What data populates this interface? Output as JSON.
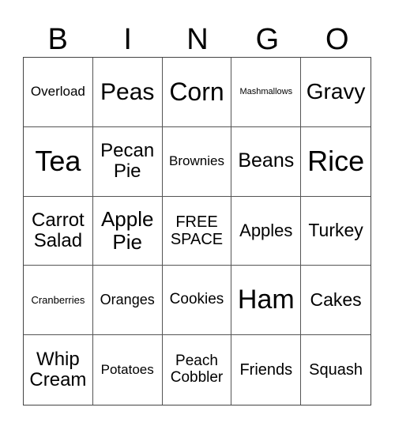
{
  "header": [
    "B",
    "I",
    "N",
    "G",
    "O"
  ],
  "cells": [
    {
      "text": "Overload",
      "size": 17
    },
    {
      "text": "Peas",
      "size": 30
    },
    {
      "text": "Corn",
      "size": 32
    },
    {
      "text": "Mashmallows",
      "size": 11
    },
    {
      "text": "Gravy",
      "size": 28
    },
    {
      "text": "Tea",
      "size": 36
    },
    {
      "text": "Pecan Pie",
      "size": 24
    },
    {
      "text": "Brownies",
      "size": 17
    },
    {
      "text": "Beans",
      "size": 25
    },
    {
      "text": "Rice",
      "size": 36
    },
    {
      "text": "Carrot Salad",
      "size": 24
    },
    {
      "text": "Apple Pie",
      "size": 26
    },
    {
      "text": "FREE SPACE",
      "size": 20
    },
    {
      "text": "Apples",
      "size": 22
    },
    {
      "text": "Turkey",
      "size": 23
    },
    {
      "text": "Cranberries",
      "size": 13
    },
    {
      "text": "Oranges",
      "size": 18
    },
    {
      "text": "Cookies",
      "size": 19
    },
    {
      "text": "Ham",
      "size": 34
    },
    {
      "text": "Cakes",
      "size": 23
    },
    {
      "text": "Whip Cream",
      "size": 24
    },
    {
      "text": "Potatoes",
      "size": 17
    },
    {
      "text": "Peach Cobbler",
      "size": 19
    },
    {
      "text": "Friends",
      "size": 20
    },
    {
      "text": "Squash",
      "size": 20
    }
  ]
}
